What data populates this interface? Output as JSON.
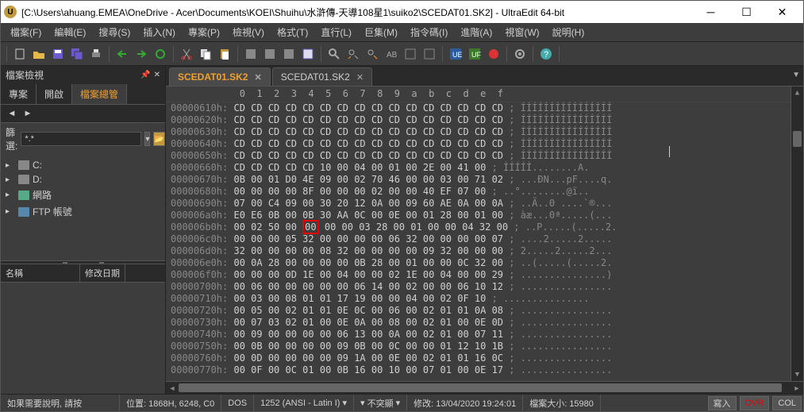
{
  "title": "[C:\\Users\\ahuang.EMEA\\OneDrive - Acer\\Documents\\KOEI\\Shuihu\\水滸傳-天導108星1\\suiko2\\SCEDAT01.SK2] - UltraEdit 64-bit",
  "menu": [
    "檔案(F)",
    "編輯(E)",
    "搜尋(S)",
    "插入(N)",
    "專案(P)",
    "檢視(V)",
    "格式(T)",
    "直行(L)",
    "巨集(M)",
    "指令碼(I)",
    "進階(A)",
    "視窗(W)",
    "說明(H)"
  ],
  "sidebar": {
    "title": "檔案檢視",
    "tabs": [
      "專案",
      "開啟",
      "檔案總管"
    ],
    "active_tab_index": 2,
    "filter_label": "篩選:",
    "filter_value": "*.*",
    "tree": [
      {
        "label": "C:",
        "expandable": true
      },
      {
        "label": "D:",
        "expandable": true
      },
      {
        "label": "網路",
        "expandable": true,
        "indent": false
      },
      {
        "label": "FTP 帳號",
        "expandable": true,
        "indent": false
      }
    ],
    "cols": [
      "名稱",
      "修改日期"
    ]
  },
  "file_tabs": [
    {
      "label": "SCEDAT01.SK2",
      "active": true
    },
    {
      "label": "SCEDAT01.SK2",
      "active": false
    }
  ],
  "hex": {
    "header": "            0  1  2  3  4  5  6  7  8  9  a  b  c  d  e  f",
    "lines": [
      {
        "addr": "00000610h:",
        "hex": "CD CD CD CD CD CD CD CD CD CD CD CD CD CD CD CD",
        "asc": "; ÍÍÍÍÍÍÍÍÍÍÍÍÍÍÍÍ"
      },
      {
        "addr": "00000620h:",
        "hex": "CD CD CD CD CD CD CD CD CD CD CD CD CD CD CD CD",
        "asc": "; ÍÍÍÍÍÍÍÍÍÍÍÍÍÍÍÍ"
      },
      {
        "addr": "00000630h:",
        "hex": "CD CD CD CD CD CD CD CD CD CD CD CD CD CD CD CD",
        "asc": "; ÍÍÍÍÍÍÍÍÍÍÍÍÍÍÍÍ"
      },
      {
        "addr": "00000640h:",
        "hex": "CD CD CD CD CD CD CD CD CD CD CD CD CD CD CD CD",
        "asc": "; ÍÍÍÍÍÍÍÍÍÍÍÍÍÍÍÍ"
      },
      {
        "addr": "00000650h:",
        "hex": "CD CD CD CD CD CD CD CD CD CD CD CD CD CD CD CD",
        "asc": "; ÍÍÍÍÍÍÍÍÍÍÍÍÍÍÍÍ"
      },
      {
        "addr": "00000660h:",
        "hex": "CD CD CD CD CD 10 00 04 00 01 00 2E 00 41 00",
        "asc": "; ÍÍÍÍÍ........A."
      },
      {
        "addr": "00000670h:",
        "hex": "0B 00 01 D0 4E 09 00 02 70 46 00 00 03 00 71 02",
        "asc": "; ...ÐN...pF....q."
      },
      {
        "addr": "00000680h:",
        "hex": "00 00 00 00 8F 00 00 00 02 00 00 40 EF 07 00",
        "asc": "; ..°........@ï.."
      },
      {
        "addr": "00000690h:",
        "hex": "07 00 C4 09 00 30 20 12 0A 00 09 60 AE 0A 00 0A",
        "asc": "; ..Ä..0 ....`®..."
      },
      {
        "addr": "000006a0h:",
        "hex": "E0 E6 0B 00 0B 30 AA 0C 00 0E 00 01 28 00 01 00",
        "asc": "; àæ...0ª.....(..."
      },
      {
        "addr": "000006b0h:",
        "hex": "00 02 50 00 ",
        "hl": "00",
        "hex2": " 00 00 03 28 00 01 00 00 04 32 00",
        "asc": "; ..P.....(.....2."
      },
      {
        "addr": "000006c0h:",
        "hex": "00 00 00 05 32 00 00 00 00 06 32 00 00 00 00 07",
        "asc": "; ....2.....2....."
      },
      {
        "addr": "000006d0h:",
        "hex": "32 00 00 00 00 08 32 00 00 00 00 09 32 00 00 00",
        "asc": "; 2.....2.....2..."
      },
      {
        "addr": "000006e0h:",
        "hex": "00 0A 28 00 00 00 00 0B 28 00 01 00 00 0C 32 00",
        "asc": "; ..(.....(.....2."
      },
      {
        "addr": "000006f0h:",
        "hex": "00 00 00 0D 1E 00 04 00 00 02 1E 00 04 00 00 29",
        "asc": "; ...............)"
      },
      {
        "addr": "00000700h:",
        "hex": "00 06 00 00 00 00 00 06 14 00 02 00 00 06 10 12",
        "asc": "; ................"
      },
      {
        "addr": "00000710h:",
        "hex": "00 03 00 08 01 01 17 19 00 00 04 00 02 0F 10",
        "asc": "; ..............."
      },
      {
        "addr": "00000720h:",
        "hex": "00 05 00 02 01 01 0E 0C 00 06 00 02 01 01 0A 08",
        "asc": "; ................"
      },
      {
        "addr": "00000730h:",
        "hex": "00 07 03 02 01 00 0E 0A 00 08 00 02 01 00 0E 0D",
        "asc": "; ................"
      },
      {
        "addr": "00000740h:",
        "hex": "00 09 00 00 00 00 06 13 00 0A 00 02 01 00 07 11",
        "asc": "; ................"
      },
      {
        "addr": "00000750h:",
        "hex": "00 0B 00 00 00 00 09 0B 00 0C 00 00 01 12 10 1B",
        "asc": "; ................"
      },
      {
        "addr": "00000760h:",
        "hex": "00 0D 00 00 00 00 09 1A 00 0E 00 02 01 01 16 0C",
        "asc": "; ................"
      },
      {
        "addr": "00000770h:",
        "hex": "00 0F 00 0C 01 00 0B 16 00 10 00 07 01 00 0E 17",
        "asc": "; ................"
      }
    ]
  },
  "status": {
    "help": "如果需要說明, 請按",
    "pos": "位置: 1868H, 6248, C0",
    "dos": "DOS",
    "enc": "1252  (ANSI - Latin I)",
    "highlight": "不突顯",
    "mod": "修改: 13/04/2020 19:24:01",
    "size": "檔案大小: 15980",
    "write": "寫入",
    "ovr": "OVR",
    "col": "COL"
  }
}
